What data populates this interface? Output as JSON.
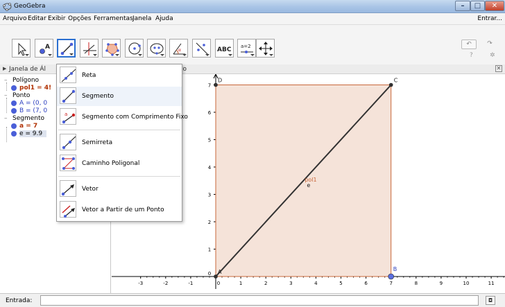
{
  "window": {
    "title": "GeoGebra"
  },
  "menubar": {
    "items": [
      "Arquivo",
      "Editar",
      "Exibir",
      "Opções",
      "Ferramentas",
      "Janela",
      "Ajuda"
    ],
    "signin": "Entrar..."
  },
  "toolbar": {
    "tools": [
      {
        "name": "move-tool-icon"
      },
      {
        "name": "point-tool-icon"
      },
      {
        "name": "segment-tool-icon",
        "active": true
      },
      {
        "name": "perpendicular-line-tool-icon"
      },
      {
        "name": "polygon-tool-icon"
      },
      {
        "name": "circle-tool-icon"
      },
      {
        "name": "ellipse-tool-icon"
      },
      {
        "name": "angle-tool-icon"
      },
      {
        "name": "reflect-tool-icon"
      },
      {
        "name": "text-tool-icon",
        "text": "ABC"
      },
      {
        "name": "slider-tool-icon",
        "text": "a=2"
      },
      {
        "name": "move-graphics-tool-icon"
      }
    ]
  },
  "algebra": {
    "header": "Janela de Ál",
    "groups": [
      {
        "name": "Polígono",
        "items": [
          {
            "text": "pol1 = 4!",
            "color": "#b03000"
          }
        ]
      },
      {
        "name": "Ponto",
        "items": [
          {
            "text": "A = (0, 0",
            "color": "#2c3fbf"
          },
          {
            "text": "B = (7, 0",
            "color": "#2c3fbf"
          }
        ]
      },
      {
        "name": "Segmento",
        "items": [
          {
            "text": "a = 7",
            "color": "#b03000"
          },
          {
            "text": "e = 9.9",
            "color": "#000000"
          }
        ]
      }
    ]
  },
  "graphics": {
    "header": "ão",
    "x_ticks": [
      "-3",
      "-2",
      "-1",
      "0",
      "1",
      "2",
      "3",
      "4",
      "5",
      "6",
      "7",
      "8",
      "9",
      "10",
      "11"
    ],
    "y_ticks": [
      "1",
      "2",
      "3",
      "4",
      "5",
      "6",
      "7"
    ],
    "points": {
      "A": "A",
      "B": "B",
      "C": "C",
      "D": "D"
    },
    "labels": {
      "polygon": "pol1",
      "segment": "e"
    },
    "colors": {
      "polygon_fill": "#f2d9cc",
      "polygon_edge": "#c8673a",
      "segment": "#333333",
      "point": "#5b6ee0"
    }
  },
  "input": {
    "label": "Entrada:"
  },
  "dropdown": {
    "items": [
      {
        "label": "Reta",
        "icon": "line-icon"
      },
      {
        "label": "Segmento",
        "icon": "segment-icon",
        "highlight": true
      },
      {
        "label": "Segmento com Comprimento Fixo",
        "icon": "fixed-segment-icon"
      },
      {
        "label": "Semirreta",
        "icon": "ray-icon"
      },
      {
        "label": "Caminho Poligonal",
        "icon": "polyline-icon"
      },
      {
        "label": "Vetor",
        "icon": "vector-icon"
      },
      {
        "label": "Vetor a Partir de um Ponto",
        "icon": "vector-from-point-icon"
      }
    ]
  }
}
